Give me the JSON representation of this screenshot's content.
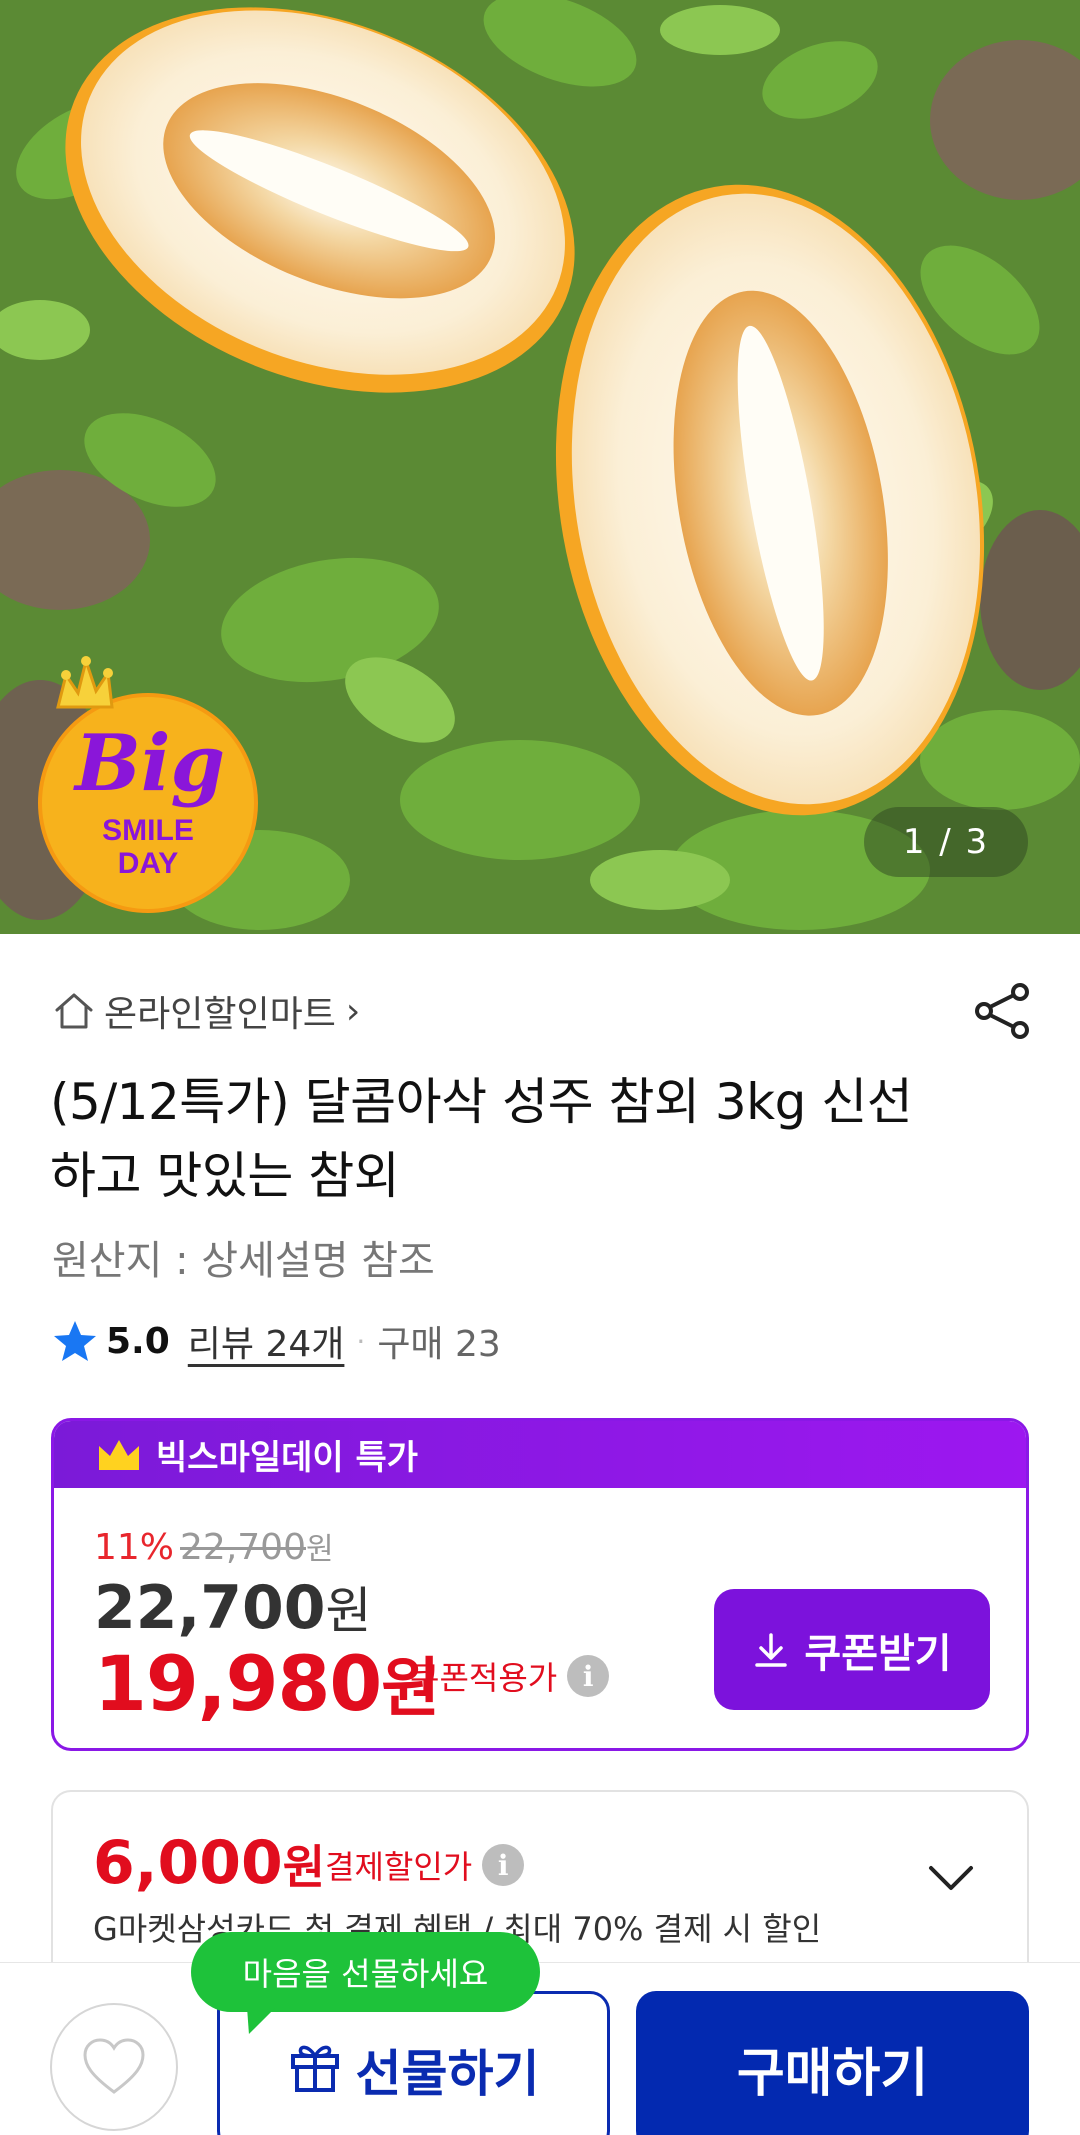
{
  "product_image": {
    "counter": "1 / 3",
    "badge": {
      "line1": "Big",
      "line2": "SMILE",
      "line3": "DAY",
      "icon": "crown-icon"
    }
  },
  "store": {
    "name": "온라인할인마트",
    "chevron": "›"
  },
  "title": "(5/12특가) 달콤아삭 성주 참외 3kg 신선하고 맛있는 참외",
  "origin": "원산지 : 상세설명 참조",
  "rating": {
    "score": "5.0",
    "reviews": "리뷰 24개",
    "separator": "·",
    "purchases": "구매 23"
  },
  "promo": {
    "header": "빅스마일데이 특가",
    "discount_rate": "11%",
    "original_price": "22,700",
    "original_unit": "원",
    "sale_price": "22,700",
    "sale_unit": "원",
    "coupon_price": "19,980",
    "coupon_unit": "원",
    "coupon_label": "쿠폰적용가",
    "coupon_button": "쿠폰받기"
  },
  "payment": {
    "price": "6,000",
    "unit": "원",
    "label": "결제할인가",
    "description": "G마켓삼성카드 첫 결제 혜택 / 최대 70% 결제 시 할인"
  },
  "bottom_bar": {
    "tooltip": "마음을 선물하세요",
    "gift_button": "선물하기",
    "buy_button": "구매하기"
  },
  "colors": {
    "promo_purple": "#8a18e6",
    "price_red": "#e10d1e",
    "buy_blue": "#0329b0",
    "tooltip_green": "#1ec23a"
  }
}
